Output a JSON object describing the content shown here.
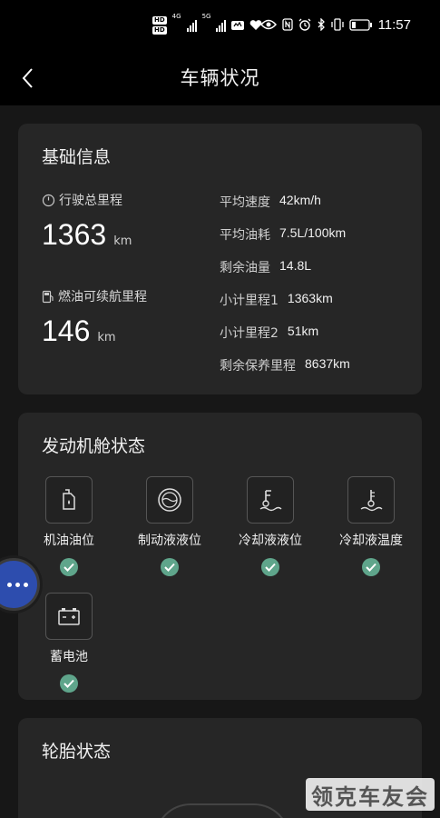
{
  "status_bar": {
    "hd_badges": [
      "HD",
      "HD"
    ],
    "network": [
      "4G",
      "5G"
    ],
    "time": "11:57"
  },
  "header": {
    "title": "车辆状况",
    "back_icon": "chevron-left-icon"
  },
  "basic_info": {
    "title": "基础信息",
    "total_mileage": {
      "label": "行驶总里程",
      "value": "1363",
      "unit": "km",
      "icon": "speedometer-icon"
    },
    "fuel_range": {
      "label": "燃油可续航里程",
      "value": "146",
      "unit": "km",
      "icon": "fuel-pump-icon"
    },
    "details": [
      {
        "key": "平均速度",
        "value": "42km/h"
      },
      {
        "key": "平均油耗",
        "value": "7.5L/100km"
      },
      {
        "key": "剩余油量",
        "value": "14.8L"
      },
      {
        "key": "小计里程1",
        "value": "1363km"
      },
      {
        "key": "小计里程2",
        "value": "51km"
      },
      {
        "key": "剩余保养里程",
        "value": "8637km"
      }
    ]
  },
  "engine": {
    "title": "发动机舱状态",
    "items": [
      {
        "label": "机油油位",
        "icon": "oil-can-icon",
        "status": "ok"
      },
      {
        "label": "制动液液位",
        "icon": "brake-fluid-icon",
        "status": "ok"
      },
      {
        "label": "冷却液液位",
        "icon": "coolant-level-icon",
        "status": "ok"
      },
      {
        "label": "冷却液温度",
        "icon": "coolant-temp-icon",
        "status": "ok"
      },
      {
        "label": "蓄电池",
        "icon": "battery-icon",
        "status": "ok"
      }
    ]
  },
  "tires": {
    "title": "轮胎状态"
  },
  "watermark": "领克车友会",
  "colors": {
    "background": "#171717",
    "card": "#262626",
    "check": "#5fa58b",
    "float_button": "#2d4dae"
  }
}
